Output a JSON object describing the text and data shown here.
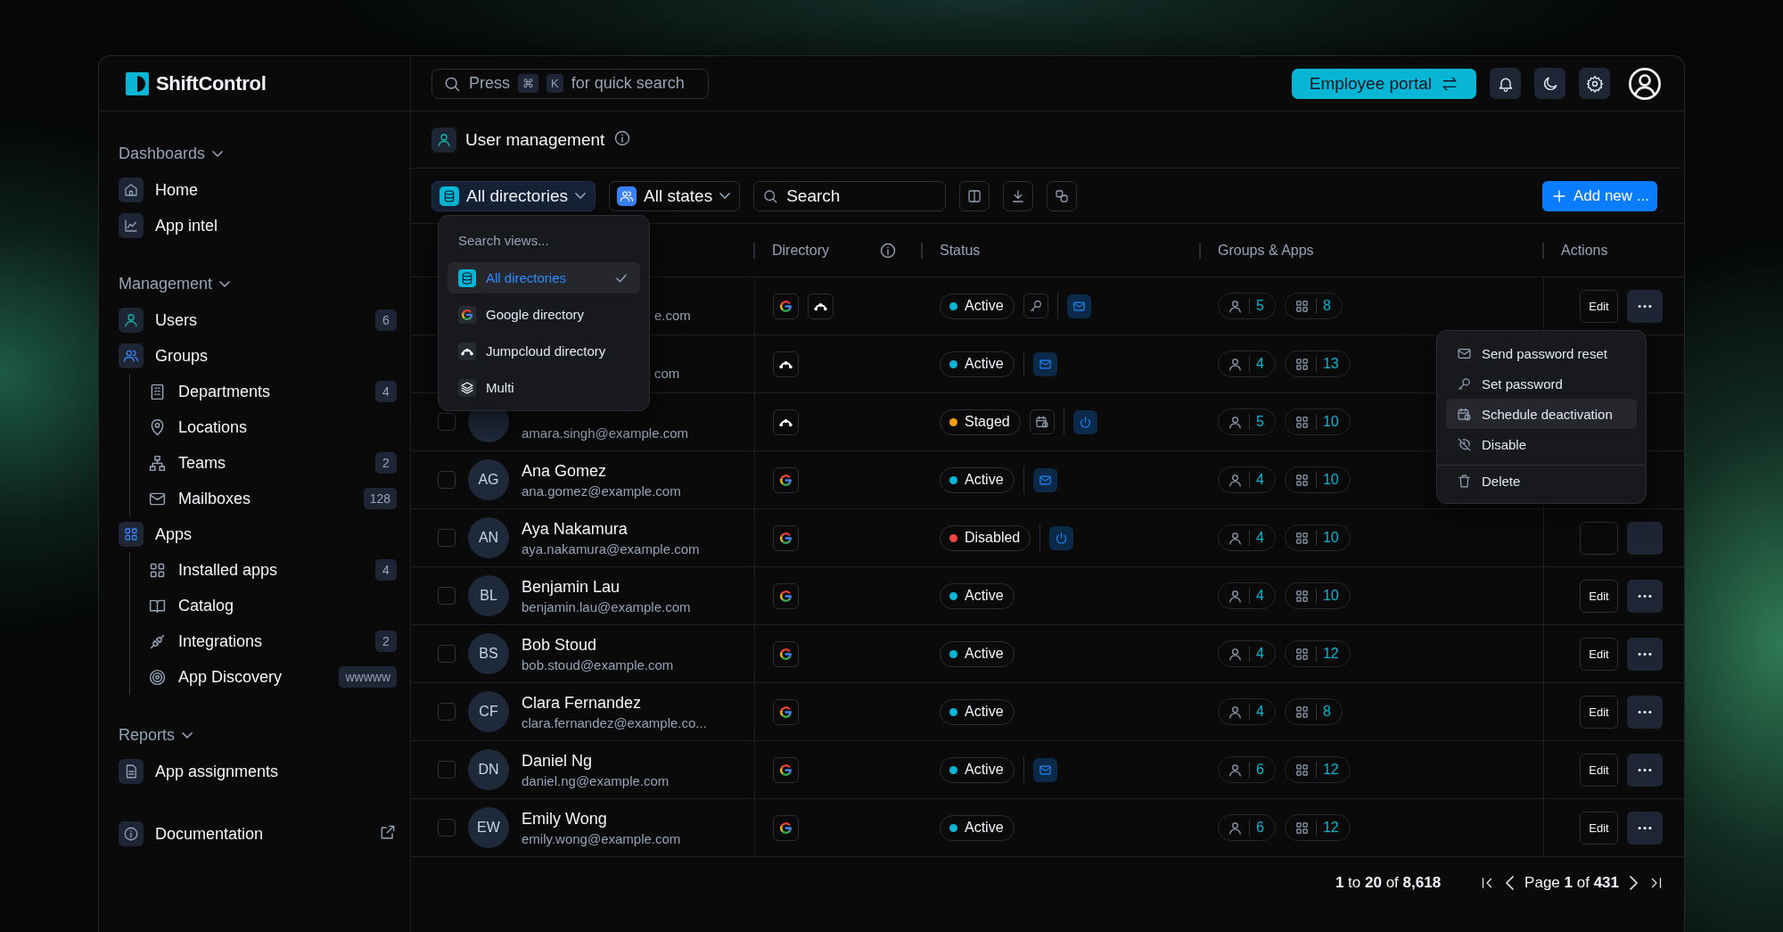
{
  "brand": {
    "name": "ShiftControl"
  },
  "sidebar": {
    "sections": [
      {
        "title": "Dashboards",
        "items": [
          {
            "kind": "home",
            "label": "Home",
            "selected": false
          },
          {
            "kind": "chart",
            "label": "App intel",
            "selected": false
          }
        ]
      },
      {
        "title": "Management",
        "items": [
          {
            "kind": "user",
            "label": "Users",
            "badge": "6",
            "selected": true
          },
          {
            "kind": "users",
            "label": "Groups",
            "selected": false,
            "children": [
              {
                "kind": "building",
                "label": "Departments",
                "badge": "4",
                "selected": false
              },
              {
                "kind": "pin",
                "label": "Locations",
                "selected": false
              },
              {
                "kind": "org",
                "label": "Teams",
                "badge": "2",
                "selected": false
              },
              {
                "kind": "mail",
                "label": "Mailboxes",
                "badge": "128",
                "selected": false
              }
            ]
          },
          {
            "kind": "grid",
            "label": "Apps",
            "selected": false,
            "children": [
              {
                "kind": "grid",
                "label": "Installed apps",
                "badge": "4",
                "selected": false
              },
              {
                "kind": "book",
                "label": "Catalog",
                "selected": false
              },
              {
                "kind": "plug",
                "label": "Integrations",
                "badge": "2",
                "selected": false
              },
              {
                "kind": "target",
                "label": "App Discovery",
                "badge": "wwwww",
                "selected": false
              }
            ]
          }
        ]
      },
      {
        "title": "Reports",
        "items": [
          {
            "kind": "file",
            "label": "App assignments",
            "selected": false
          }
        ]
      }
    ],
    "footer_link": {
      "label": "Documentation"
    }
  },
  "topbar": {
    "search": {
      "prefix": "Press",
      "keys": [
        "⌘",
        "K"
      ],
      "suffix": "for quick search"
    },
    "portal_button": "Employee portal"
  },
  "page": {
    "title": "User management"
  },
  "toolbar": {
    "filters": [
      {
        "kind": "database",
        "label": "All directories",
        "open": true
      },
      {
        "kind": "users",
        "label": "All states",
        "open": false
      }
    ],
    "search": {
      "placeholder": "Search"
    },
    "tools": [
      {
        "kind": "columns"
      },
      {
        "kind": "download"
      },
      {
        "kind": "link"
      }
    ],
    "add_button": "Add new ..."
  },
  "table": {
    "columns": [
      {
        "label": "Directory",
        "info": true
      },
      {
        "label": "Status",
        "info": false
      },
      {
        "label": "Groups & Apps",
        "info": false
      },
      {
        "label": "Actions",
        "info": false
      }
    ],
    "rows": [
      {
        "kind": "covered",
        "email": "e.com",
        "directories": [
          {
            "kind": "google"
          },
          {
            "kind": "jumpcloud"
          }
        ],
        "status": {
          "label": "Active",
          "color": "#06b6d4"
        },
        "status_tool": {
          "kind": "key"
        },
        "quick_action": {
          "kind": "mail"
        },
        "groups": "5",
        "apps": "8",
        "actions": {
          "kind": "full",
          "edit": "Edit"
        }
      },
      {
        "kind": "covered",
        "email": "com",
        "directories": [
          {
            "kind": "jumpcloud"
          }
        ],
        "status": {
          "label": "Active",
          "color": "#06b6d4"
        },
        "quick_action": {
          "kind": "mail"
        },
        "groups": "4",
        "apps": "13"
      },
      {
        "kind": "partial",
        "checked": false,
        "email": "amara.singh@example.com",
        "directories": [
          {
            "kind": "jumpcloud"
          }
        ],
        "status": {
          "label": "Staged",
          "color": "#f59e0b"
        },
        "status_tool": {
          "kind": "calendar"
        },
        "quick_action": {
          "kind": "power"
        },
        "groups": "5",
        "apps": "10"
      },
      {
        "kind": "full",
        "checked": false,
        "initials": "AG",
        "name": "Ana Gomez",
        "email": "ana.gomez@example.com",
        "directories": [
          {
            "kind": "google"
          }
        ],
        "status": {
          "label": "Active",
          "color": "#06b6d4"
        },
        "quick_action": {
          "kind": "mail"
        },
        "groups": "4",
        "apps": "10"
      },
      {
        "kind": "full",
        "checked": false,
        "initials": "AN",
        "name": "Aya Nakamura",
        "email": "aya.nakamura@example.com",
        "directories": [
          {
            "kind": "google"
          }
        ],
        "status": {
          "label": "Disabled",
          "color": "#ef4444"
        },
        "quick_action": {
          "kind": "power"
        },
        "groups": "4",
        "apps": "10",
        "actions": {
          "kind": "covered"
        }
      },
      {
        "kind": "full",
        "checked": false,
        "initials": "BL",
        "name": "Benjamin Lau",
        "email": "benjamin.lau@example.com",
        "directories": [
          {
            "kind": "google"
          }
        ],
        "status": {
          "label": "Active",
          "color": "#06b6d4"
        },
        "groups": "4",
        "apps": "10",
        "actions": {
          "kind": "full",
          "edit": "Edit"
        }
      },
      {
        "kind": "full",
        "checked": false,
        "initials": "BS",
        "name": "Bob Stoud",
        "email": "bob.stoud@example.com",
        "directories": [
          {
            "kind": "google"
          }
        ],
        "status": {
          "label": "Active",
          "color": "#06b6d4"
        },
        "groups": "4",
        "apps": "12",
        "actions": {
          "kind": "full",
          "edit": "Edit"
        }
      },
      {
        "kind": "full",
        "checked": false,
        "initials": "CF",
        "name": "Clara Fernandez",
        "email": "clara.fernandez@example.co...",
        "directories": [
          {
            "kind": "google"
          }
        ],
        "status": {
          "label": "Active",
          "color": "#06b6d4"
        },
        "groups": "4",
        "apps": "8",
        "actions": {
          "kind": "full",
          "edit": "Edit"
        }
      },
      {
        "kind": "full",
        "checked": false,
        "initials": "DN",
        "name": "Daniel Ng",
        "email": "daniel.ng@example.com",
        "directories": [
          {
            "kind": "google"
          }
        ],
        "status": {
          "label": "Active",
          "color": "#06b6d4"
        },
        "quick_action": {
          "kind": "mail"
        },
        "groups": "6",
        "apps": "12",
        "actions": {
          "kind": "full",
          "edit": "Edit"
        }
      },
      {
        "kind": "full",
        "checked": false,
        "initials": "EW",
        "name": "Emily Wong",
        "email": "emily.wong@example.com",
        "directories": [
          {
            "kind": "google"
          }
        ],
        "status": {
          "label": "Active",
          "color": "#06b6d4"
        },
        "groups": "6",
        "apps": "12",
        "actions": {
          "kind": "full",
          "edit": "Edit"
        }
      }
    ]
  },
  "directory_menu": {
    "search": {
      "placeholder": "Search views..."
    },
    "items": [
      {
        "kind": "database",
        "label": "All directories",
        "selected": true
      },
      {
        "kind": "google",
        "label": "Google directory",
        "selected": false
      },
      {
        "kind": "jumpcloud",
        "label": "Jumpcloud directory",
        "selected": false
      },
      {
        "kind": "layers",
        "label": "Multi",
        "selected": false
      }
    ]
  },
  "row_menu": {
    "items": [
      {
        "kind": "mail",
        "label": "Send password reset",
        "selected": false,
        "divider_before": false
      },
      {
        "kind": "key",
        "label": "Set password",
        "selected": false,
        "divider_before": false
      },
      {
        "kind": "calendar",
        "label": "Schedule deactivation",
        "selected": true,
        "divider_before": false
      },
      {
        "kind": "timeroff",
        "label": "Disable",
        "selected": false,
        "divider_before": false
      },
      {
        "kind": "trash",
        "label": "Delete",
        "selected": false,
        "divider_before": true
      }
    ]
  },
  "footer": {
    "range": "**1** to **20** of **8,618**",
    "page": "Page **1** of **431**"
  }
}
